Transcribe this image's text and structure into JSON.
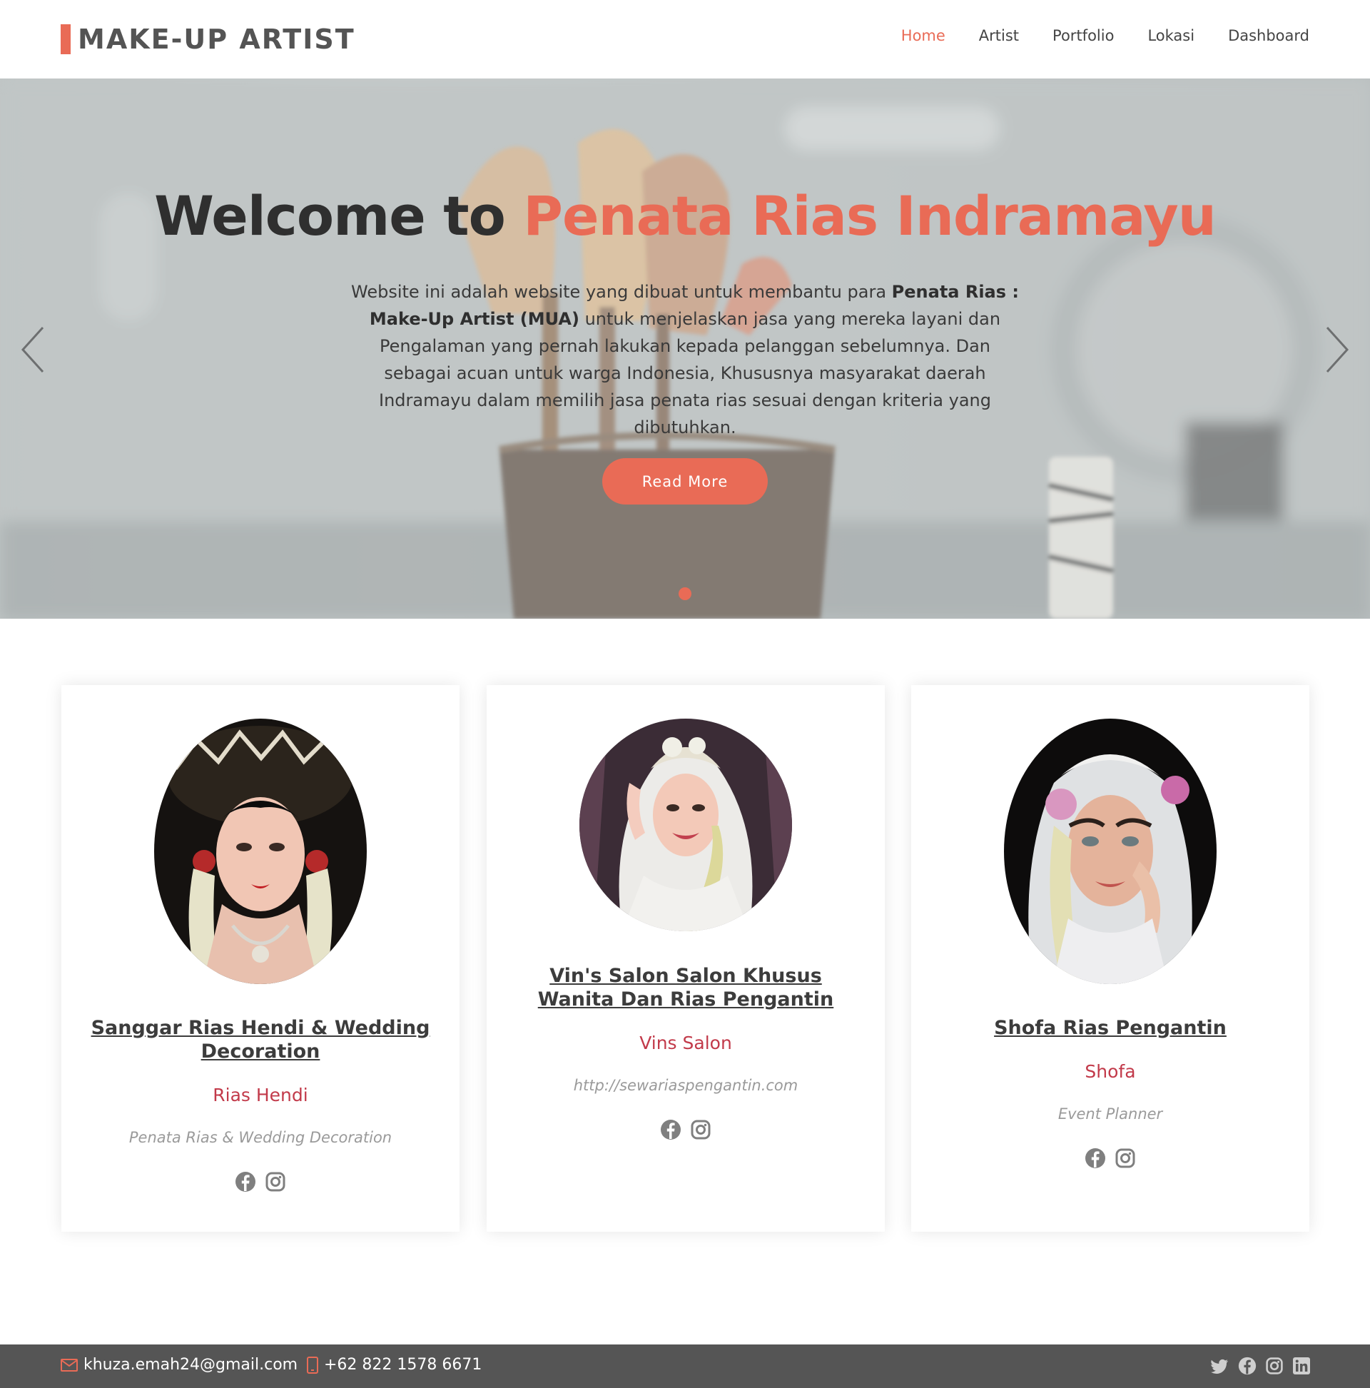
{
  "header": {
    "logo_text": "MAKE-UP ARTIST",
    "nav": [
      {
        "label": "Home",
        "active": true
      },
      {
        "label": "Artist",
        "active": false
      },
      {
        "label": "Portfolio",
        "active": false
      },
      {
        "label": "Lokasi",
        "active": false
      },
      {
        "label": "Dashboard",
        "active": false
      }
    ]
  },
  "hero": {
    "title_prefix": "Welcome to ",
    "title_accent": "Penata Rias Indramayu",
    "desc_part1": "Website ini adalah website yang dibuat untuk membantu para ",
    "desc_bold": "Penata Rias : Make-Up Artist (MUA)",
    "desc_part2": " untuk menjelaskan jasa yang mereka layani dan Pengalaman yang pernah lakukan kepada pelanggan sebelumnya. Dan sebagai acuan untuk warga Indonesia, Khususnya masyarakat daerah Indramayu dalam memilih jasa penata rias sesuai dengan kriteria yang dibutuhkan.",
    "button_label": "Read More",
    "slide_count": 1,
    "active_slide": 1
  },
  "artists": [
    {
      "title": "Sanggar Rias Hendi & Wedding Decoration",
      "name": "Rias Hendi",
      "role": "Penata Rias & Wedding Decoration",
      "social": [
        "facebook-icon",
        "instagram-icon"
      ]
    },
    {
      "title": "Vin's Salon Salon Khusus Wanita Dan Rias Pengantin",
      "name": "Vins Salon",
      "role": "http://sewariaspengantin.com",
      "social": [
        "facebook-icon",
        "instagram-icon"
      ]
    },
    {
      "title": "Shofa Rias Pengantin",
      "name": "Shofa",
      "role": "Event Planner",
      "social": [
        "facebook-icon",
        "instagram-icon"
      ]
    }
  ],
  "footer": {
    "email": "khuza.emah24@gmail.com",
    "phone": "+62 822 1578 6671",
    "social": [
      "twitter-icon",
      "facebook-icon",
      "instagram-icon",
      "linkedin-icon"
    ]
  },
  "colors": {
    "accent": "#e96b56",
    "artist_name": "#c23a4a",
    "footer_bg": "#555555"
  }
}
